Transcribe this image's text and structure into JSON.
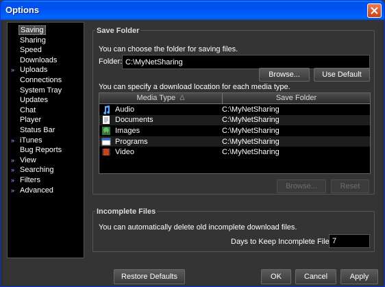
{
  "window": {
    "title": "Options"
  },
  "sidebar": {
    "items": [
      {
        "label": "Saving",
        "expandable": false,
        "selected": true
      },
      {
        "label": "Sharing",
        "expandable": false
      },
      {
        "label": "Speed",
        "expandable": false
      },
      {
        "label": "Downloads",
        "expandable": false
      },
      {
        "label": "Uploads",
        "expandable": true
      },
      {
        "label": "Connections",
        "expandable": false
      },
      {
        "label": "System Tray",
        "expandable": false
      },
      {
        "label": "Updates",
        "expandable": false
      },
      {
        "label": "Chat",
        "expandable": false
      },
      {
        "label": "Player",
        "expandable": false
      },
      {
        "label": "Status Bar",
        "expandable": false
      },
      {
        "label": "iTunes",
        "expandable": true
      },
      {
        "label": "Bug Reports",
        "expandable": false
      },
      {
        "label": "View",
        "expandable": true
      },
      {
        "label": "Searching",
        "expandable": true
      },
      {
        "label": "Filters",
        "expandable": true
      },
      {
        "label": "Advanced",
        "expandable": true
      }
    ]
  },
  "save_folder": {
    "title": "Save Folder",
    "description": "You can choose the folder for saving files.",
    "folder_label": "Folder:",
    "folder_value": "C:\\MyNetSharing",
    "browse_label": "Browse...",
    "use_default_label": "Use Default",
    "media_description": "You can specify a download location for each media type.",
    "table": {
      "columns": [
        "Media Type",
        "Save Folder"
      ],
      "sort_indicator": "Δ",
      "rows": [
        {
          "type": "Audio",
          "folder": "C:\\MyNetSharing",
          "icon": "audio-icon"
        },
        {
          "type": "Documents",
          "folder": "C:\\MyNetSharing",
          "icon": "document-icon"
        },
        {
          "type": "Images",
          "folder": "C:\\MyNetSharing",
          "icon": "image-icon"
        },
        {
          "type": "Programs",
          "folder": "C:\\MyNetSharing",
          "icon": "program-icon"
        },
        {
          "type": "Video",
          "folder": "C:\\MyNetSharing",
          "icon": "video-icon"
        }
      ]
    },
    "table_browse_label": "Browse...",
    "table_reset_label": "Reset"
  },
  "incomplete_files": {
    "title": "Incomplete Files",
    "description": "You can automatically delete old incomplete download files.",
    "days_label": "Days to Keep Incomplete Files:",
    "days_value": "7"
  },
  "footer": {
    "restore_defaults_label": "Restore Defaults",
    "ok_label": "OK",
    "cancel_label": "Cancel",
    "apply_label": "Apply"
  }
}
